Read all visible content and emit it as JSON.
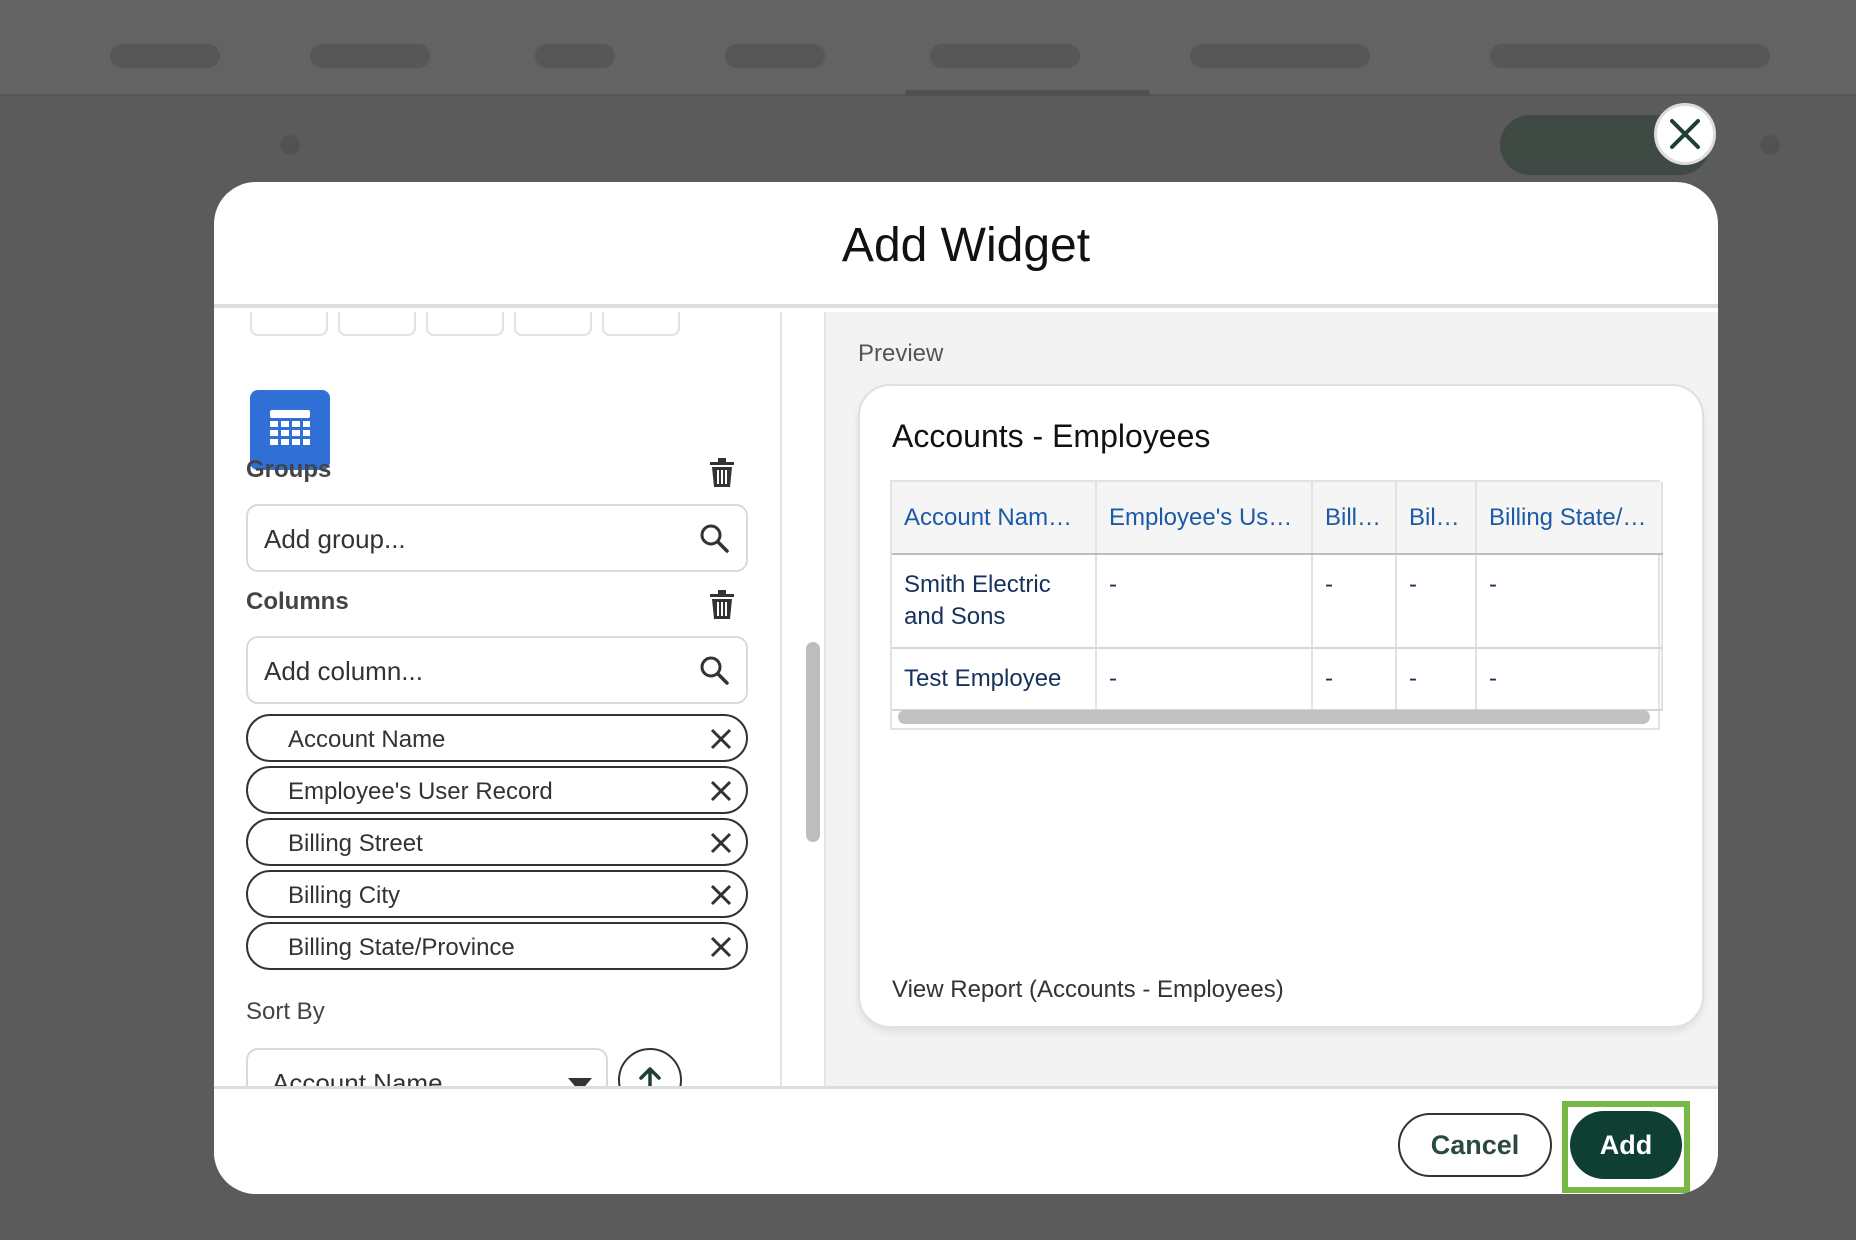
{
  "modal": {
    "title": "Add Widget",
    "close_icon": "close-icon"
  },
  "left": {
    "chart_type_icons": [
      "pie-chart-icon",
      "bar-chart-icon",
      "column-chart-icon",
      "line-chart-icon",
      "scatter-chart-icon"
    ],
    "selected_type_icon": "table-grid-icon",
    "groups": {
      "label": "Groups",
      "placeholder": "Add group..."
    },
    "columns": {
      "label": "Columns",
      "placeholder": "Add column...",
      "items": [
        "Account Name",
        "Employee's User Record",
        "Billing Street",
        "Billing City",
        "Billing State/Province"
      ]
    },
    "sort": {
      "label": "Sort By",
      "value": "Account Name",
      "direction_icon": "arrow-up-icon"
    }
  },
  "preview": {
    "label": "Preview",
    "card_title": "Accounts - Employees",
    "table": {
      "headers": [
        "Account Nam…",
        "Employee's Us…",
        "Bill…",
        "Bil…",
        "Billing State/…"
      ],
      "rows": [
        [
          "Smith Electric and Sons",
          "-",
          "-",
          "-",
          "-"
        ],
        [
          "Test Employee",
          "-",
          "-",
          "-",
          "-"
        ]
      ]
    },
    "view_report": "View Report (Accounts - Employees)"
  },
  "footer": {
    "cancel_label": "Cancel",
    "add_label": "Add"
  },
  "colors": {
    "accent_dark_green": "#0f3e33",
    "highlight_green": "#77b744",
    "selected_type_blue": "#2f6fd6",
    "link_blue": "#1b5aa6"
  }
}
